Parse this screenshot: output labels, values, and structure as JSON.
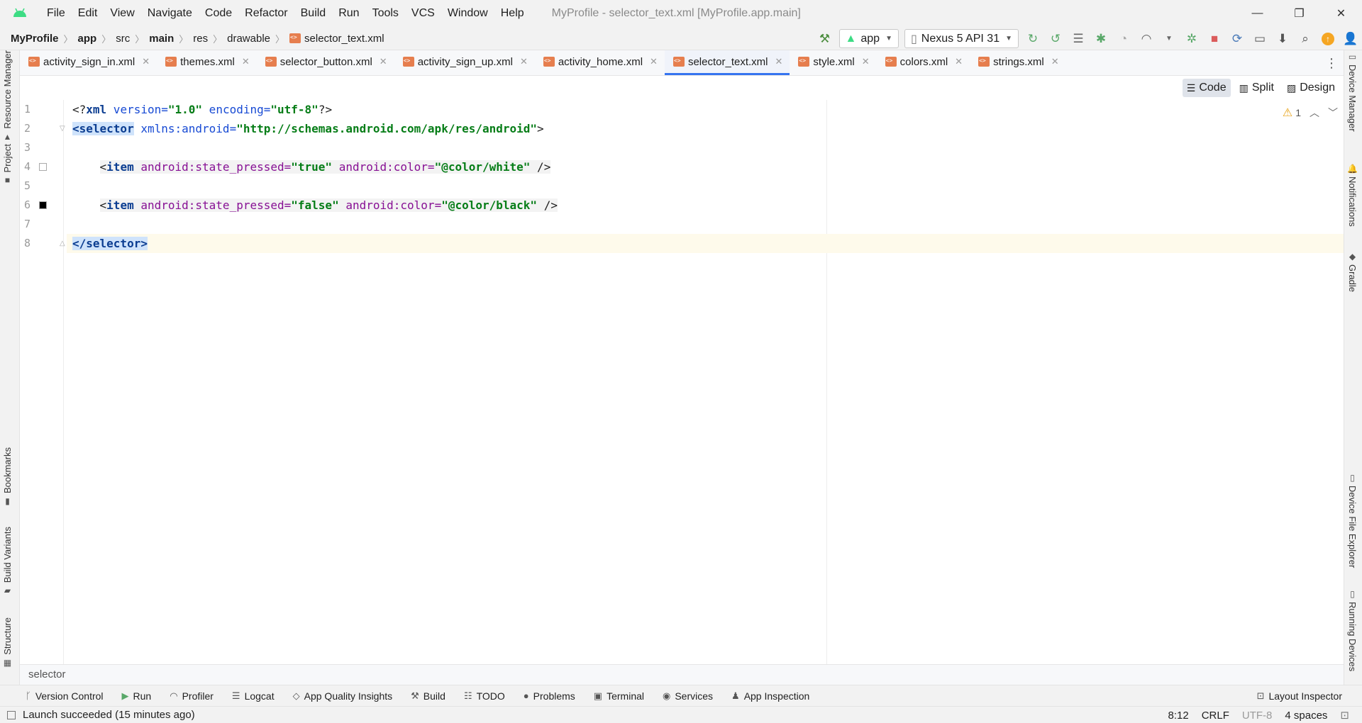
{
  "window": {
    "title": "MyProfile - selector_text.xml [MyProfile.app.main]",
    "controls": {
      "minimize": "—",
      "maximize": "❐",
      "close": "✕"
    }
  },
  "menu": [
    "File",
    "Edit",
    "View",
    "Navigate",
    "Code",
    "Refactor",
    "Build",
    "Run",
    "Tools",
    "VCS",
    "Window",
    "Help"
  ],
  "breadcrumb": [
    "MyProfile",
    "app",
    "src",
    "main",
    "res",
    "drawable",
    "selector_text.xml"
  ],
  "toolbar": {
    "run_config": "app",
    "device": "Nexus 5 API 31"
  },
  "tabs": [
    {
      "label": "activity_sign_in.xml",
      "close": "✕"
    },
    {
      "label": "themes.xml",
      "close": "✕"
    },
    {
      "label": "selector_button.xml",
      "close": "✕"
    },
    {
      "label": "activity_sign_up.xml",
      "close": "✕"
    },
    {
      "label": "activity_home.xml",
      "close": "✕"
    },
    {
      "label": "selector_text.xml",
      "close": "✕",
      "active": true
    },
    {
      "label": "style.xml",
      "close": "✕"
    },
    {
      "label": "colors.xml",
      "close": "✕"
    },
    {
      "label": "strings.xml",
      "close": "✕"
    }
  ],
  "editor_modes": {
    "code": "Code",
    "split": "Split",
    "design": "Design"
  },
  "inspections": {
    "warnings": "1"
  },
  "code": {
    "line_numbers": [
      "1",
      "2",
      "3",
      "4",
      "5",
      "6",
      "7",
      "8"
    ],
    "l1": {
      "open": "<?",
      "tag": "xml",
      "a1": " version=",
      "v1": "\"1.0\"",
      "a2": " encoding=",
      "v2": "\"utf-8\"",
      "close": "?>"
    },
    "l2": {
      "tag": "<selector",
      "ns": " xmlns:android=",
      "val": "\"http://schemas.android.com/apk/res/android\"",
      "close": ">"
    },
    "l4": {
      "open": "<",
      "tag": "item",
      "a1": " android:state_pressed=",
      "v1": "\"true\"",
      "a2": " android:color=",
      "v2": "\"@color/white\"",
      "close": " />"
    },
    "l6": {
      "open": "<",
      "tag": "item",
      "a1": " android:state_pressed=",
      "v1": "\"false\"",
      "a2": " android:color=",
      "v2": "\"@color/black\"",
      "close": " />"
    },
    "l8": {
      "tag": "</selector>"
    }
  },
  "swatches": {
    "white": "#ffffff",
    "black": "#000000"
  },
  "structure_path": "selector",
  "left_tools": [
    "Resource Manager",
    "Project",
    "Bookmarks",
    "Build Variants",
    "Structure"
  ],
  "right_tools": [
    "Device Manager",
    "Notifications",
    "Gradle",
    "Device File Explorer",
    "Running Devices"
  ],
  "bottom_tools": [
    "Version Control",
    "Run",
    "Profiler",
    "Logcat",
    "App Quality Insights",
    "Build",
    "TODO",
    "Problems",
    "Terminal",
    "Services",
    "App Inspection"
  ],
  "layout_inspector": "Layout Inspector",
  "status": {
    "message": "Launch succeeded (15 minutes ago)",
    "position": "8:12",
    "line_sep": "CRLF",
    "encoding": "UTF-8",
    "indent": "4 spaces"
  },
  "colors": {
    "accent": "#3574f0",
    "run": "#59a869",
    "stop": "#db5c5c",
    "update": "#f5a623"
  }
}
